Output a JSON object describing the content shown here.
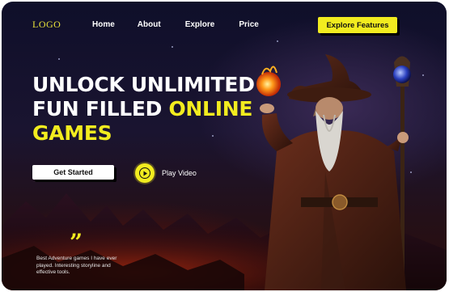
{
  "header": {
    "logo": "LOGO",
    "nav": [
      "Home",
      "About",
      "Explore",
      "Price"
    ],
    "cta_label": "Explore Features"
  },
  "hero": {
    "line1": "UNLOCK UNLIMITED",
    "line2_white": "FUN FILLED ",
    "line2_accent": "ONLINE",
    "line3_accent": "GAMES",
    "start_label": "Get Started",
    "play_label": "Play Video"
  },
  "testimonial": {
    "quote_mark": "”",
    "text": "Best Adventure games I have ever played. Interesting storyline and effective tools."
  },
  "colors": {
    "accent": "#f2ec1f",
    "background": "#141228",
    "text": "#ffffff"
  },
  "illustration": {
    "subject": "wizard-illustration",
    "icons": [
      "fireball-icon",
      "staff-orb-icon",
      "play-icon"
    ]
  }
}
